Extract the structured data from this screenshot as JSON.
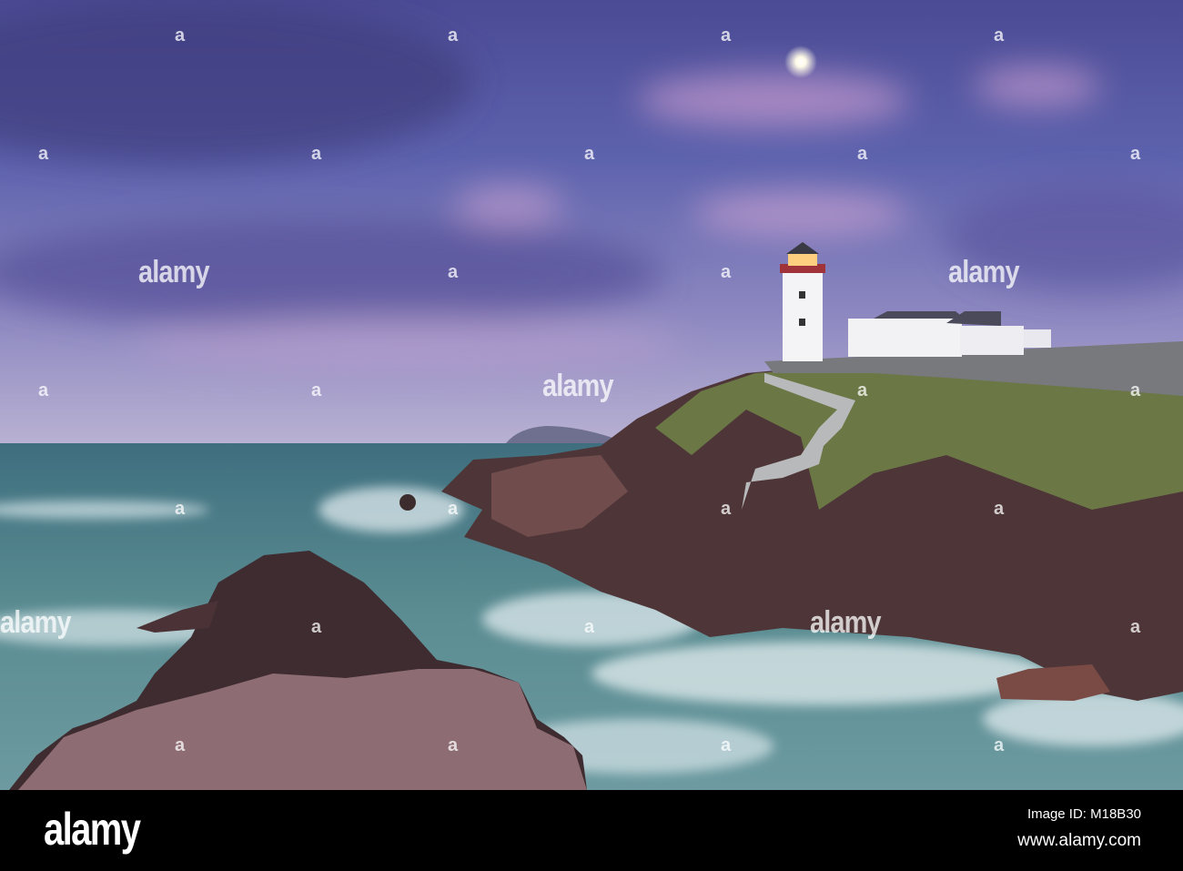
{
  "photo": {
    "subject": "lighthouse-on-rocky-coast",
    "colors": {
      "sky_top": "#4a4f9a",
      "sky_horizon": "#b7aed0",
      "sea": "#4f7f86",
      "rock": "#5a3c3e",
      "grass": "#6d7a45"
    }
  },
  "watermark": {
    "text": "alamy",
    "mark": "a"
  },
  "footer": {
    "logo": "alamy",
    "image_id": "Image ID: M18B30",
    "url": "www.alamy.com"
  }
}
